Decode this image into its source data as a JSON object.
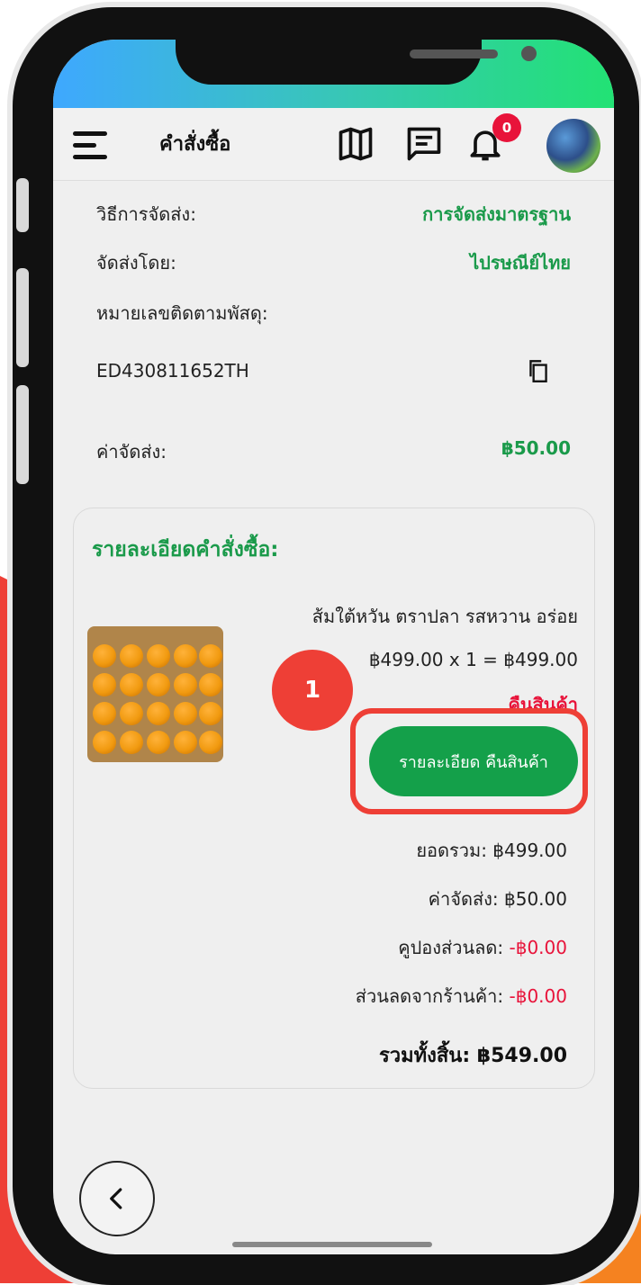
{
  "header": {
    "title": "คำสั่งซื้อ",
    "notification_count": "0"
  },
  "shipping": {
    "method_label": "วิธีการจัดส่ง:",
    "method_value": "การจัดส่งมาตรฐาน",
    "carrier_label": "จัดส่งโดย:",
    "carrier_value": "ไปรษณีย์ไทย",
    "tracking_label": "หมายเลขติดตามพัสดุ:",
    "tracking_number": "ED430811652TH",
    "fee_label": "ค่าจัดส่ง:",
    "fee_value": "฿50.00"
  },
  "order": {
    "title": "รายละเอียดคำสั่งซื้อ:",
    "product_name": "ส้มใต้หวัน ตราปลา รสหวาน อร่อย",
    "price_line": "฿499.00 x 1 = ฿499.00",
    "return_status": "คืนสินค้า",
    "return_detail_button": "รายละเอียด  คืนสินค้า",
    "subtotal": "ยอดรวม: ฿499.00",
    "shipping_fee": "ค่าจัดส่ง: ฿50.00",
    "coupon_label": "คูปองส่วนลด: ",
    "coupon_value": "-฿0.00",
    "shop_discount_label": "ส่วนลดจากร้านค้า: ",
    "shop_discount_value": "-฿0.00",
    "total": "รวมทั้งสิ้น:  ฿549.00"
  },
  "annotation": {
    "step_number": "1"
  },
  "colors": {
    "accent_green": "#1a9a4a",
    "button_green": "#14a04a",
    "alert_red": "#e8133a",
    "callout_red": "#ee3f36"
  },
  "icons": [
    "hamburger-icon",
    "map-icon",
    "chat-icon",
    "bell-icon",
    "copy-icon",
    "back-arrow-icon"
  ]
}
